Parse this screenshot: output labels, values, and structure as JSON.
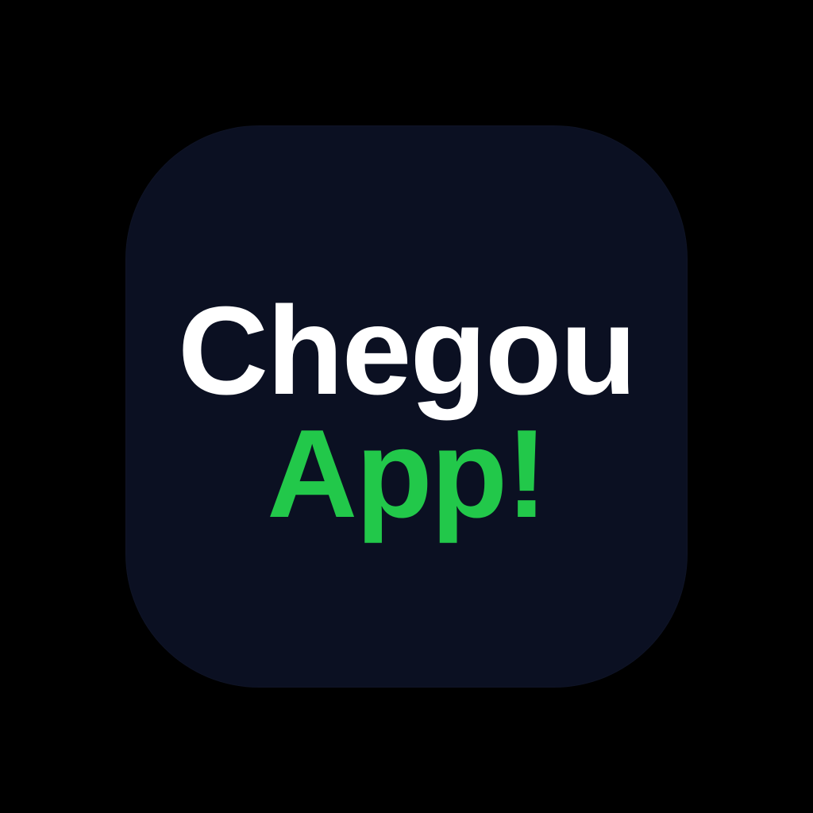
{
  "logo": {
    "line1": "Chegou",
    "line2": "App!",
    "colors": {
      "background": "#000000",
      "tile": "#0b1022",
      "line1": "#ffffff",
      "line2": "#22c84a"
    }
  }
}
